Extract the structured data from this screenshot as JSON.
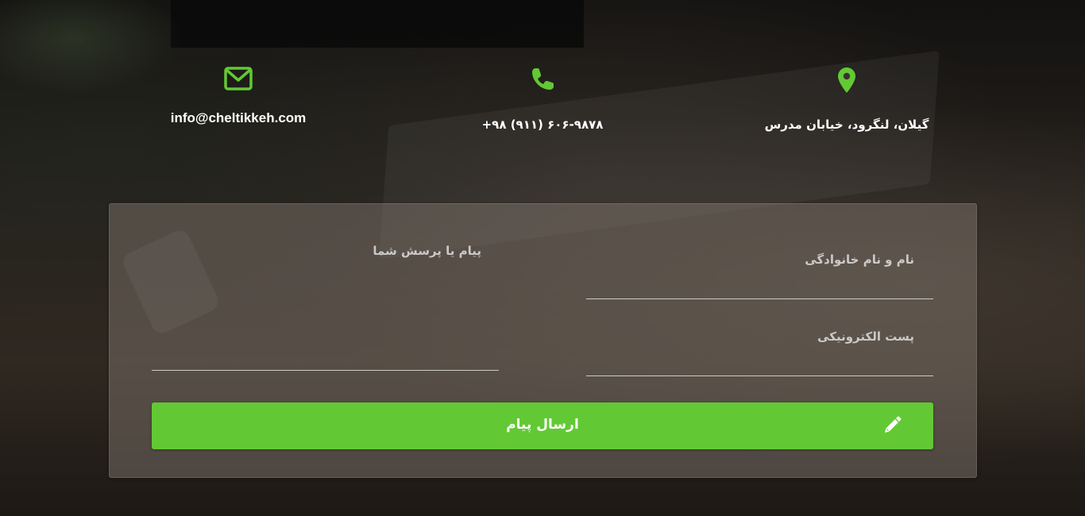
{
  "contact": {
    "email": "info@cheltikkeh.com",
    "phone": "+۹۸ (۹۱۱) ۶۰۶-۹۸۷۸",
    "address": "گیلان، لنگرود، خیابان مدرس"
  },
  "form": {
    "name_label": "نام و نام خانوادگی",
    "email_label": "پست الکترونیکی",
    "message_label": "پیام یا پرسش شما",
    "name_value": "",
    "email_value": "",
    "message_value": "",
    "submit_label": "ارسال پیام"
  },
  "icons": {
    "email": "envelope-icon",
    "phone": "phone-icon",
    "address": "map-pin-icon",
    "submit": "pencil-icon"
  },
  "colors": {
    "accent": "#62c934",
    "text": "#ffffff"
  }
}
